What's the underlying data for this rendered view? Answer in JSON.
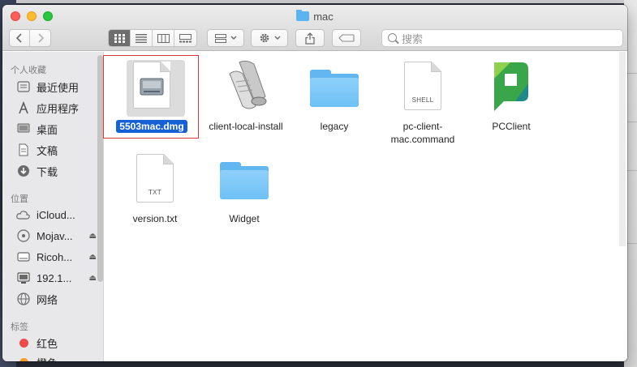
{
  "window": {
    "title": "mac"
  },
  "toolbar": {
    "search_placeholder": "搜索"
  },
  "sidebar": {
    "favorites_header": "个人收藏",
    "favorites": [
      {
        "label": "最近使用",
        "icon": "recents-icon"
      },
      {
        "label": "应用程序",
        "icon": "applications-icon"
      },
      {
        "label": "桌面",
        "icon": "desktop-icon"
      },
      {
        "label": "文稿",
        "icon": "documents-icon"
      },
      {
        "label": "下载",
        "icon": "downloads-icon"
      }
    ],
    "locations_header": "位置",
    "locations": [
      {
        "label": "iCloud...",
        "icon": "icloud-icon",
        "eject": false
      },
      {
        "label": "Mojav...",
        "icon": "disk-icon",
        "eject": true
      },
      {
        "label": "Ricoh...",
        "icon": "drive-icon",
        "eject": true
      },
      {
        "label": "192.1...",
        "icon": "server-icon",
        "eject": true
      },
      {
        "label": "网络",
        "icon": "network-icon",
        "eject": false
      }
    ],
    "tags_header": "标签",
    "tags": [
      {
        "label": "红色",
        "color": "#f04b4b"
      },
      {
        "label": "橙色",
        "color": "#f39c2c"
      }
    ]
  },
  "files": [
    {
      "name": "5503mac.dmg",
      "kind": "disk-image-icon",
      "selected": true
    },
    {
      "name": "client-local-install",
      "kind": "script-icon",
      "selected": false
    },
    {
      "name": "legacy",
      "kind": "folder-icon",
      "selected": false
    },
    {
      "name_line1": "pc-client-",
      "name_line2": "mac.command",
      "badge": "SHELL",
      "kind": "shell-icon",
      "selected": false
    },
    {
      "name": "PCClient",
      "kind": "pcclient-app-icon",
      "selected": false
    },
    {
      "name": "version.txt",
      "badge": "TXT",
      "kind": "text-file-icon",
      "selected": false
    },
    {
      "name": "Widget",
      "kind": "folder-icon",
      "selected": false
    }
  ],
  "colors": {
    "selection": "#1560d4",
    "folder": "#62b7f0",
    "annotation_box": "#d83a3a"
  }
}
